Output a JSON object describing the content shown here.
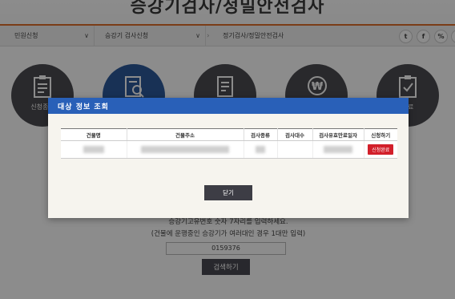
{
  "page": {
    "title": "승강기검사/정밀안전검사"
  },
  "breadcrumb": {
    "item1": "민원신청",
    "item2": "승강기 검사신청",
    "item3": "정기검사/정밀안전검사"
  },
  "social": [
    "twitter-icon",
    "facebook-icon",
    "link-icon",
    "share-icon"
  ],
  "steps": [
    {
      "label": "신청종류",
      "icon": "clipboard-icon"
    },
    {
      "label": "",
      "icon": "document-search-icon"
    },
    {
      "label": "",
      "icon": "document-icon"
    },
    {
      "label": "",
      "icon": "won-coin-icon"
    },
    {
      "label": "완료",
      "icon": "check-clipboard-icon"
    }
  ],
  "background_form": {
    "instruction1": "승강기고유번호 숫자 7자리를 입력하세요.",
    "instruction2": "(건물에 운행중인 승강기가 여러대인 경우 1대만 입력)",
    "input_value": "0159376",
    "search_label": "검색하기"
  },
  "modal": {
    "title": "대상 정보 조회",
    "columns": [
      "건물명",
      "건물주소",
      "검사종류",
      "검사대수",
      "검사유효만료일자",
      "신청하기"
    ],
    "apply_label": "신청완료",
    "close_label": "닫기"
  },
  "colors": {
    "modal_header": "#2960b8",
    "accent_orange": "#e0702a",
    "badge_red": "#d21f2a"
  }
}
